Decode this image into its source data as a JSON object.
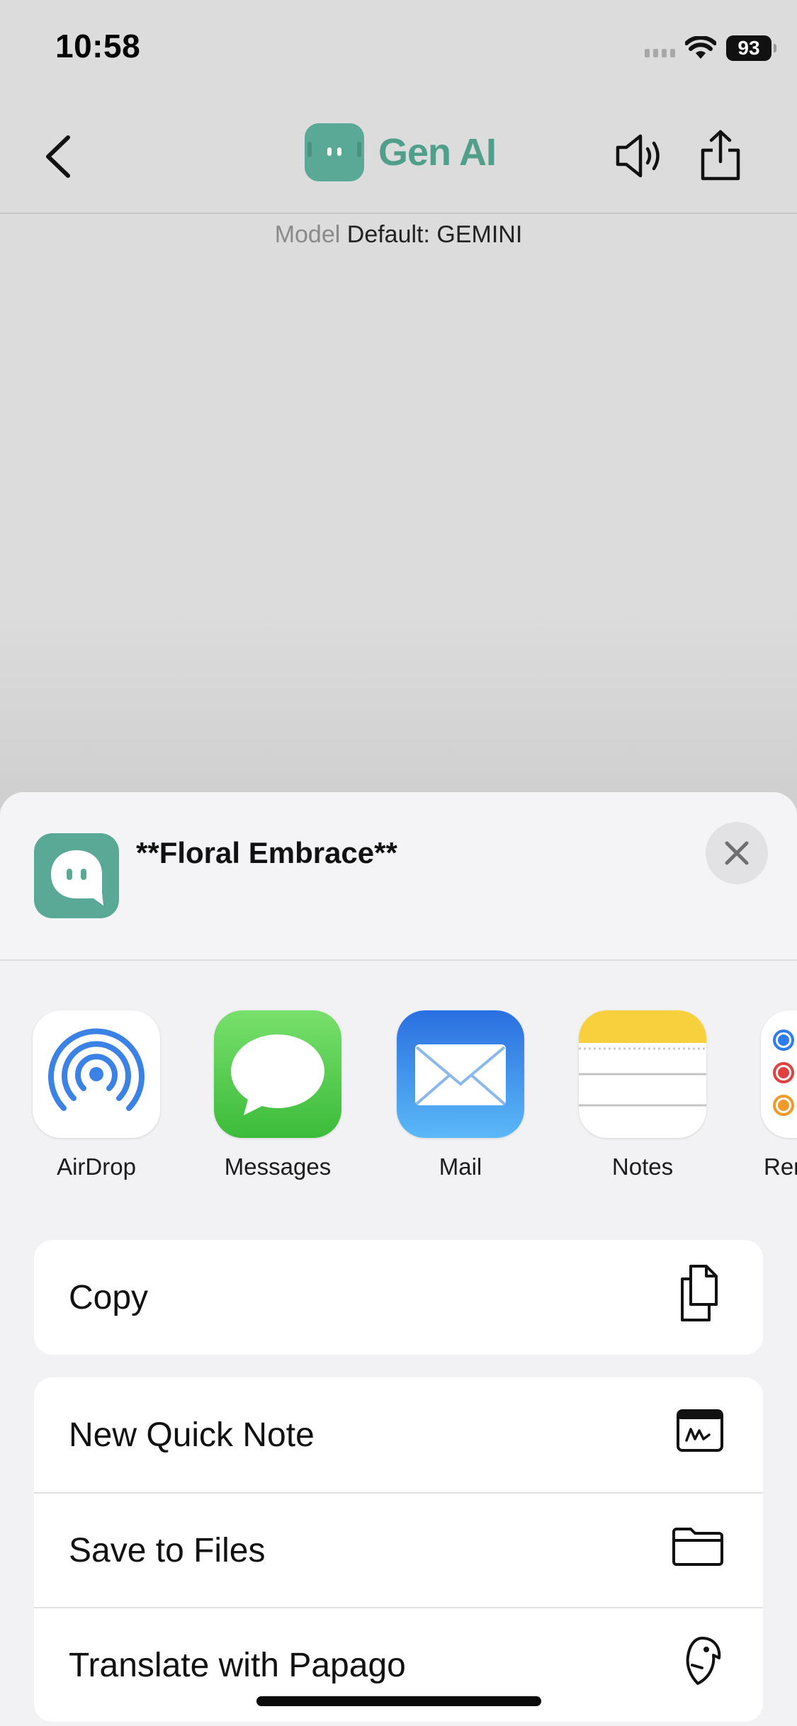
{
  "status_bar": {
    "time": "10:58",
    "battery": "93"
  },
  "nav": {
    "brand_name": "Gen AI"
  },
  "model": {
    "label": "Model",
    "value": "Default: GEMINI"
  },
  "share_sheet": {
    "title": "**Floral Embrace**",
    "apps": [
      {
        "label": "AirDrop",
        "icon": "airdrop-icon"
      },
      {
        "label": "Messages",
        "icon": "messages-icon"
      },
      {
        "label": "Mail",
        "icon": "mail-icon"
      },
      {
        "label": "Notes",
        "icon": "notes-icon"
      },
      {
        "label": "Rer",
        "icon": "reminders-icon"
      }
    ],
    "actions_group1": [
      {
        "label": "Copy",
        "icon": "copy-icon"
      }
    ],
    "actions_group2": [
      {
        "label": "New Quick Note",
        "icon": "quick-note-icon"
      },
      {
        "label": "Save to Files",
        "icon": "folder-icon"
      },
      {
        "label": "Translate with Papago",
        "icon": "papago-icon"
      }
    ]
  },
  "colors": {
    "brand": "#5aa896",
    "brand_text": "#4f9f8a",
    "sheet_bg": "#f2f2f4"
  }
}
